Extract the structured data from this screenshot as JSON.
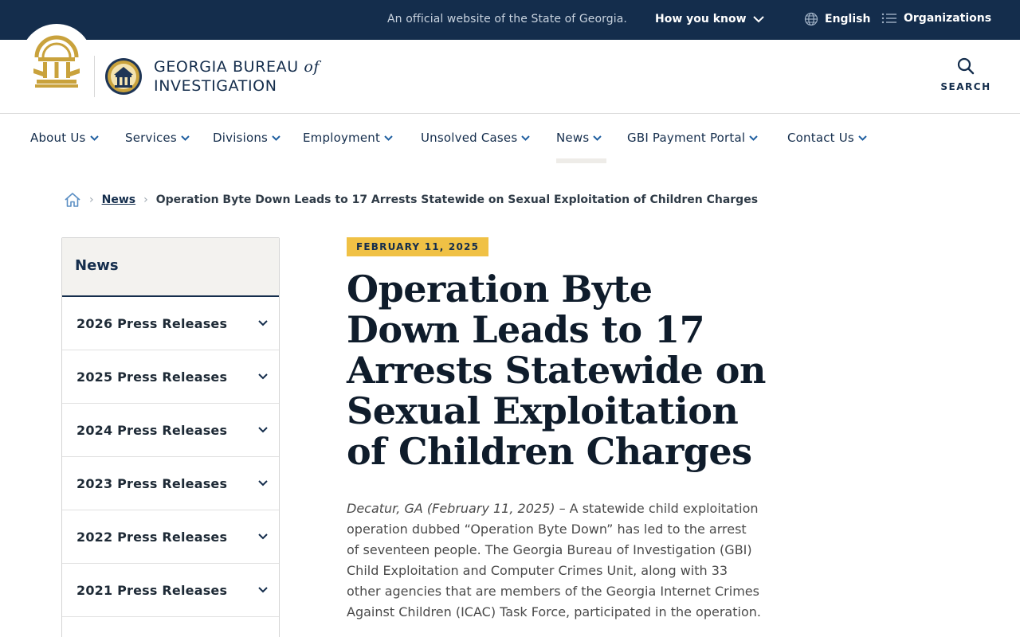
{
  "topbar": {
    "official_text": "An official website of the State of Georgia.",
    "how_you_know": "How you know",
    "language": "English",
    "organizations": "Organizations"
  },
  "header": {
    "agency_line1": "GEORGIA BUREAU",
    "agency_of": "of",
    "agency_line2": "INVESTIGATION",
    "search_label": "SEARCH"
  },
  "nav": {
    "items": [
      {
        "label": "About Us"
      },
      {
        "label": "Services"
      },
      {
        "label": "Divisions"
      },
      {
        "label": "Employment"
      },
      {
        "label": "Unsolved Cases"
      },
      {
        "label": "News"
      },
      {
        "label": "GBI Payment Portal"
      },
      {
        "label": "Contact Us"
      }
    ],
    "active": "News"
  },
  "breadcrumb": {
    "home_icon": "home-icon",
    "link": "News",
    "current": "Operation Byte Down Leads to 17 Arrests Statewide on Sexual Exploitation of Children Charges"
  },
  "sidebar": {
    "heading": "News",
    "items": [
      {
        "label": "2026 Press Releases"
      },
      {
        "label": "2025 Press Releases"
      },
      {
        "label": "2024 Press Releases"
      },
      {
        "label": "2023 Press Releases"
      },
      {
        "label": "2022 Press Releases"
      },
      {
        "label": "2021 Press Releases"
      }
    ]
  },
  "article": {
    "date": "FEBRUARY 11, 2025",
    "title": "Operation Byte Down Leads to 17 Arrests Statewide on Sexual Exploitation of Children Charges",
    "dateline": "Decatur, GA (February 11, 2025)",
    "body": " – A statewide child exploitation operation dubbed “Operation Byte Down” has led to the arrest of seventeen people. The Georgia Bureau of Investigation (GBI) Child Exploitation and Computer Crimes Unit, along with 33 other agencies that are members of the Georgia Internet Crimes Against Children (ICAC) Task Force, participated in the operation."
  },
  "colors": {
    "navy": "#142d4c",
    "gold": "#f0c145",
    "seal_gold": "#c9a23c"
  }
}
